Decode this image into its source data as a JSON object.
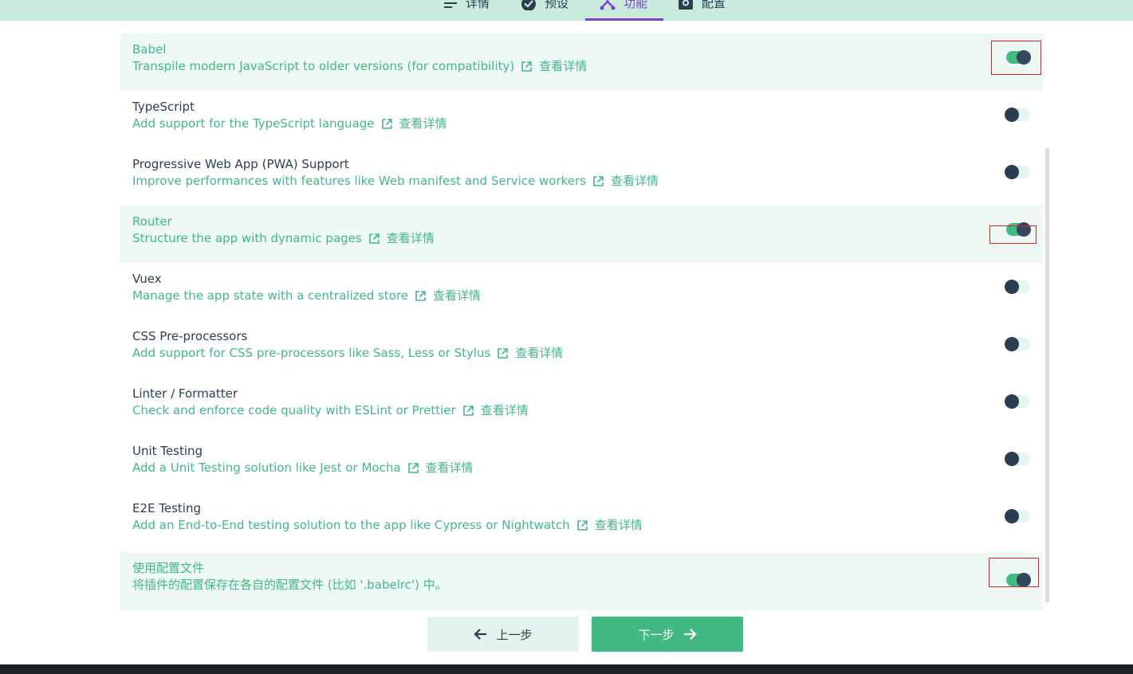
{
  "tabs": [
    {
      "label": "详情",
      "icon": "list-icon"
    },
    {
      "label": "预设",
      "icon": "check-circle-icon"
    },
    {
      "label": "功能",
      "icon": "fork-icon",
      "active": true
    },
    {
      "label": "配置",
      "icon": "gear-icon"
    }
  ],
  "features": [
    {
      "name": "Babel",
      "description": "Transpile modern JavaScript to older versions (for compatibility)",
      "link": "查看详情",
      "enabled": true
    },
    {
      "name": "TypeScript",
      "description": "Add support for the TypeScript language",
      "link": "查看详情",
      "enabled": false
    },
    {
      "name": "Progressive Web App (PWA) Support",
      "description": "Improve performances with features like Web manifest and Service workers",
      "link": "查看详情",
      "enabled": false
    },
    {
      "name": "Router",
      "description": "Structure the app with dynamic pages",
      "link": "查看详情",
      "enabled": true
    },
    {
      "name": "Vuex",
      "description": "Manage the app state with a centralized store",
      "link": "查看详情",
      "enabled": false
    },
    {
      "name": "CSS Pre-processors",
      "description": "Add support for CSS pre-processors like Sass, Less or Stylus",
      "link": "查看详情",
      "enabled": false
    },
    {
      "name": "Linter / Formatter",
      "description": "Check and enforce code quality with ESLint or Prettier",
      "link": "查看详情",
      "enabled": false
    },
    {
      "name": "Unit Testing",
      "description": "Add a Unit Testing solution like Jest or Mocha",
      "link": "查看详情",
      "enabled": false
    },
    {
      "name": "E2E Testing",
      "description": "Add an End-to-End testing solution to the app like Cypress or Nightwatch",
      "link": "查看详情",
      "enabled": false
    }
  ],
  "config_option": {
    "name": "使用配置文件",
    "description": "将插件的配置保存在各自的配置文件 (比如 '.babelrc') 中。",
    "enabled": true
  },
  "buttons": {
    "prev": "上一步",
    "next": "下一步"
  },
  "colors": {
    "accent": "#42b983",
    "tab_active": "#7f3fd0",
    "topbar": "#c9ebde",
    "text": "#2c3e50"
  }
}
